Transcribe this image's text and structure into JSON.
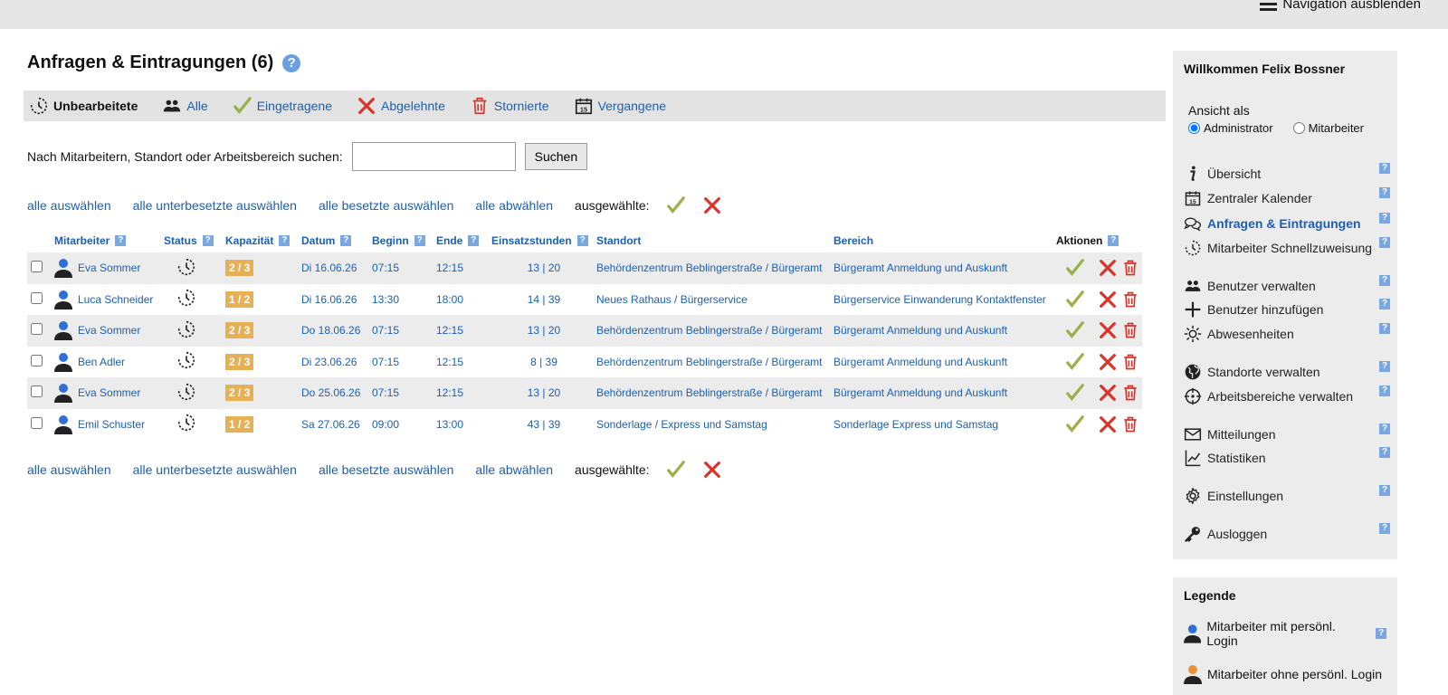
{
  "nav": {
    "toggle_label": "Navigation ausblenden"
  },
  "page": {
    "title": "Anfragen & Eintragungen (6)",
    "help": "?"
  },
  "tabs": [
    {
      "label": "Unbearbeitete",
      "icon": "clock-dotted-icon"
    },
    {
      "label": "Alle",
      "icon": "users-icon"
    },
    {
      "label": "Eingetragene",
      "icon": "check-icon"
    },
    {
      "label": "Abgelehnte",
      "icon": "cross-icon"
    },
    {
      "label": "Stornierte",
      "icon": "trash-icon"
    },
    {
      "label": "Vergangene",
      "icon": "calendar-icon"
    }
  ],
  "search": {
    "label": "Nach Mitarbeitern, Standort oder Arbeitsbereich suchen:",
    "value": "",
    "button": "Suchen"
  },
  "bulk": {
    "select_all": "alle auswählen",
    "select_understaffed": "alle unterbesetzte auswählen",
    "select_staffed": "alle besetzte auswählen",
    "deselect_all": "alle abwählen",
    "selected_label": "ausgewählte:"
  },
  "table": {
    "headers": {
      "employee": "Mitarbeiter",
      "status": "Status",
      "capacity": "Kapazität",
      "date": "Datum",
      "start": "Beginn",
      "end": "Ende",
      "hours": "Einsatzstunden",
      "location": "Standort",
      "area": "Bereich",
      "actions": "Aktionen"
    },
    "help": "?",
    "rows": [
      {
        "employee": "Eva Sommer",
        "capacity": "2 / 3",
        "date": "Di 16.06.26",
        "start": "07:15",
        "end": "12:15",
        "hours": "13 | 20",
        "location": "Behördenzentrum Beblingerstraße / Bürgeramt",
        "area": "Bürgeramt Anmeldung und Auskunft"
      },
      {
        "employee": "Luca Schneider",
        "capacity": "1 / 2",
        "date": "Di 16.06.26",
        "start": "13:30",
        "end": "18:00",
        "hours": "14 | 39",
        "location": "Neues Rathaus / Bürgerservice",
        "area": "Bürgerservice Einwanderung Kontaktfenster"
      },
      {
        "employee": "Eva Sommer",
        "capacity": "2 / 3",
        "date": "Do 18.06.26",
        "start": "07:15",
        "end": "12:15",
        "hours": "13 | 20",
        "location": "Behördenzentrum Beblingerstraße / Bürgeramt",
        "area": "Bürgeramt Anmeldung und Auskunft"
      },
      {
        "employee": "Ben Adler",
        "capacity": "2 / 3",
        "date": "Di 23.06.26",
        "start": "07:15",
        "end": "12:15",
        "hours": "8 | 39",
        "location": "Behördenzentrum Beblingerstraße / Bürgeramt",
        "area": "Bürgeramt Anmeldung und Auskunft"
      },
      {
        "employee": "Eva Sommer",
        "capacity": "2 / 3",
        "date": "Do 25.06.26",
        "start": "07:15",
        "end": "12:15",
        "hours": "13 | 20",
        "location": "Behördenzentrum Beblingerstraße / Bürgeramt",
        "area": "Bürgeramt Anmeldung und Auskunft"
      },
      {
        "employee": "Emil Schuster",
        "capacity": "1 / 2",
        "date": "Sa 27.06.26",
        "start": "09:00",
        "end": "13:00",
        "hours": "43 | 39",
        "location": "Sonderlage / Express und Samstag",
        "area": "Sonderlage Express und Samstag"
      }
    ]
  },
  "sidebar": {
    "welcome": "Willkommen Felix Bossner",
    "view_as": "Ansicht als",
    "role_admin": "Administrator",
    "role_employee": "Mitarbeiter",
    "selected_role": "Administrator",
    "help": "?",
    "menu": [
      {
        "label": "Übersicht",
        "icon": "info-icon"
      },
      {
        "label": "Zentraler Kalender",
        "icon": "calendar-icon"
      },
      {
        "label": "Anfragen & Eintragungen",
        "icon": "speech-bubbles-icon",
        "active": true
      },
      {
        "label": "Mitarbeiter Schnellzuweisung",
        "icon": "clock-dotted-icon"
      },
      {
        "label": "Benutzer verwalten",
        "icon": "users-icon"
      },
      {
        "label": "Benutzer hinzufügen",
        "icon": "plus-icon"
      },
      {
        "label": "Abwesenheiten",
        "icon": "sun-icon"
      },
      {
        "label": "Standorte verwalten",
        "icon": "globe-icon"
      },
      {
        "label": "Arbeitsbereiche verwalten",
        "icon": "crosshair-icon"
      },
      {
        "label": "Mitteilungen",
        "icon": "envelope-icon"
      },
      {
        "label": "Statistiken",
        "icon": "chart-icon"
      },
      {
        "label": "Einstellungen",
        "icon": "gear-icon"
      },
      {
        "label": "Ausloggen",
        "icon": "key-icon"
      }
    ]
  },
  "legend": {
    "title": "Legende",
    "items": [
      {
        "label": "Mitarbeiter mit persönl. Login",
        "color": "#2f6fd6"
      },
      {
        "label": "Mitarbeiter ohne persönl. Login",
        "color": "#e8903a"
      }
    ]
  },
  "colors": {
    "link": "#1a5fb4",
    "accept": "#9bb04a",
    "reject": "#d9342b",
    "capacity": "#e8b055"
  }
}
